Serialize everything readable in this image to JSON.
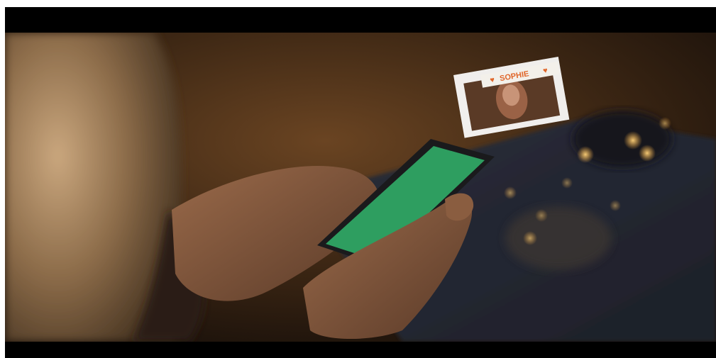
{
  "scene": {
    "description_elements": [
      "phone",
      "hands",
      "floating-profile-card",
      "bokeh-lights",
      "table"
    ],
    "screen_color": "#2e9e60",
    "accent_color": "#e0662a"
  },
  "profile_card": {
    "name": "SOPHIE",
    "left_icon": "heart-icon",
    "right_icon": "heart-icon"
  }
}
